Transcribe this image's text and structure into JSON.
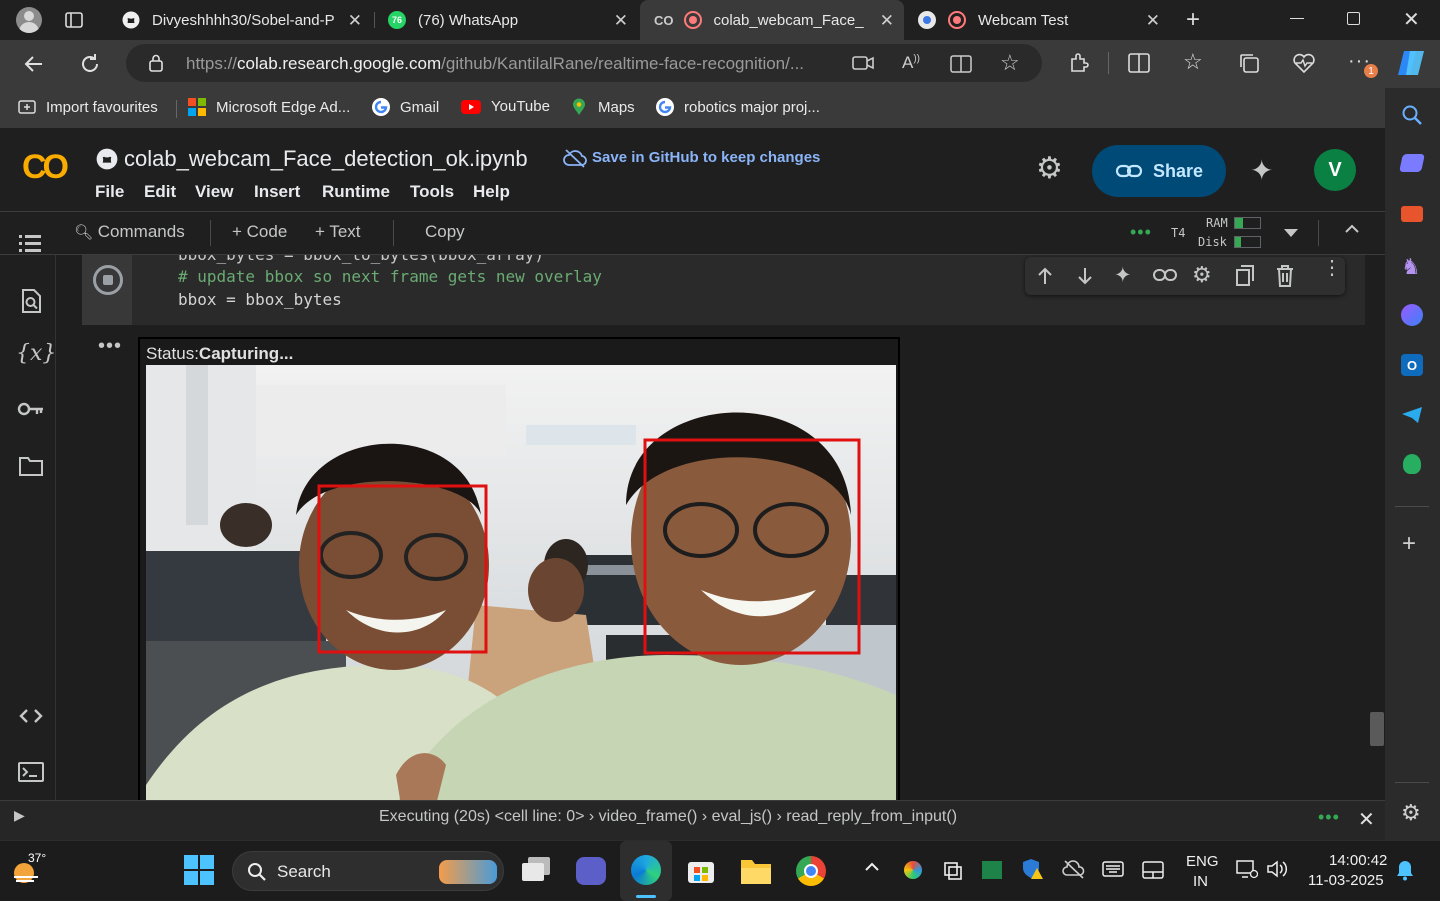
{
  "browser": {
    "tabs": [
      {
        "title": "Divyeshhhh30/Sobel-and-P",
        "active": false
      },
      {
        "title": "(76) WhatsApp",
        "badge": "76",
        "active": false
      },
      {
        "title": "colab_webcam_Face_de",
        "active": true
      },
      {
        "title": "Webcam Test",
        "active": false
      }
    ],
    "url_prefix": "https://",
    "url_domain": "colab.research.google.com",
    "url_path": "/github/KantilalRane/realtime-face-recognition/...",
    "favourites": [
      {
        "label": "Import favourites",
        "icon": "import-icon"
      },
      {
        "label": "Microsoft Edge Ad...",
        "icon": "microsoft-icon"
      },
      {
        "label": "Gmail",
        "icon": "google-icon"
      },
      {
        "label": "YouTube",
        "icon": "youtube-icon"
      },
      {
        "label": "Maps",
        "icon": "maps-icon"
      },
      {
        "label": "robotics major proj...",
        "icon": "google-icon"
      }
    ],
    "notification_badge": "1"
  },
  "colab": {
    "logo": "CO",
    "notebook_title": "colab_webcam_Face_detection_ok.ipynb",
    "save_github": "Save in GitHub to keep changes",
    "menus": [
      "File",
      "Edit",
      "View",
      "Insert",
      "Runtime",
      "Tools",
      "Help"
    ],
    "share_label": "Share",
    "avatar_letter": "V",
    "toolbar": {
      "commands": "Commands",
      "code": "+ Code",
      "text": "+ Text",
      "copy": "Copy",
      "runtime_type": "T4",
      "ram": "RAM",
      "disk": "Disk"
    },
    "code": {
      "line_partial": "bbox_bytes = bbox_to_bytes(bbox_array)",
      "comment": "# update bbox so next frame gets new overlay",
      "assign": "bbox = bbox_bytes"
    },
    "output": {
      "status_label": "Status:",
      "status_value": "Capturing..."
    },
    "status_bar": {
      "exec": "Executing (20s)  <cell line: 0>  ›  video_frame()  ›  eval_js()  ›  read_reply_from_input()"
    }
  },
  "taskbar": {
    "weather": "37°",
    "search_placeholder": "Search",
    "lang_top": "ENG",
    "lang_bottom": "IN",
    "time": "14:00:42",
    "date": "11-03-2025"
  },
  "colors": {
    "colab_orange": "#F9AB00",
    "share_bg": "#004A77",
    "link_blue": "#8AB4F8",
    "comment_green": "#6AAB73",
    "face_box": "#E01010"
  }
}
